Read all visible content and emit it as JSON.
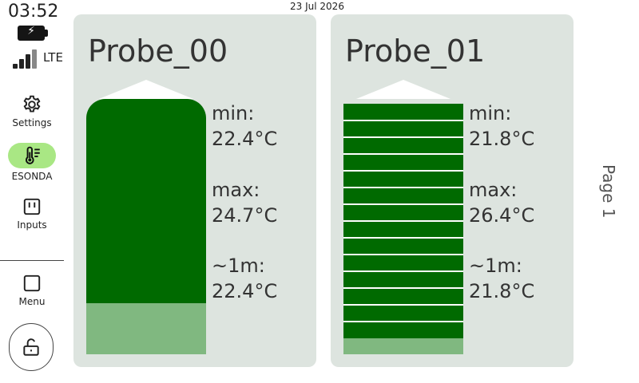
{
  "status": {
    "time": "03:52",
    "network": "LTE",
    "date": "23 Jul 2026"
  },
  "nav": {
    "settings": "Settings",
    "esonda": "ESONDA",
    "inputs": "Inputs",
    "menu": "Menu"
  },
  "probes": [
    {
      "name": "Probe_00",
      "min_label": "min:",
      "min_value": "22.4°C",
      "max_label": "max:",
      "max_value": "24.7°C",
      "avg_label": "~1m:",
      "avg_value": "22.4°C",
      "style": "solid"
    },
    {
      "name": "Probe_01",
      "min_label": "min:",
      "min_value": "21.8°C",
      "max_label": "max:",
      "max_value": "26.4°C",
      "avg_label": "~1m:",
      "avg_value": "21.8°C",
      "style": "segmented"
    }
  ],
  "page": "Page 1",
  "colors": {
    "accent_active": "#a9e784",
    "level_fill": "#006a00",
    "level_base": "#80b880",
    "card_bg": "#dde4df"
  }
}
